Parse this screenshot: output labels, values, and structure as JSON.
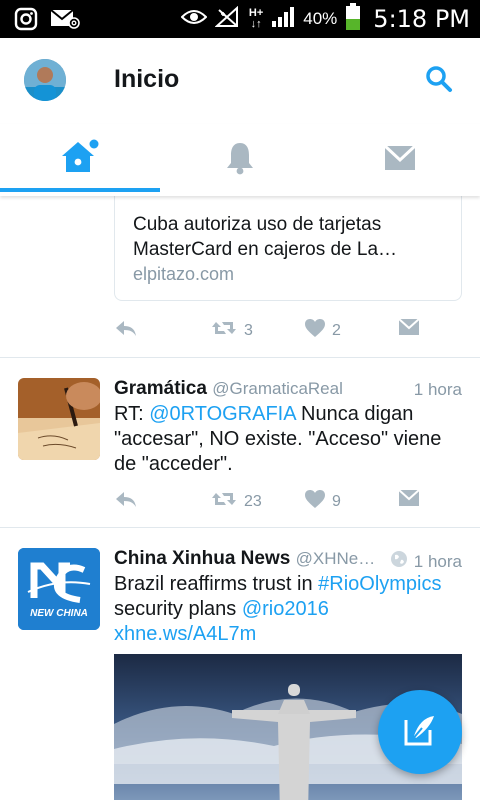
{
  "status_bar": {
    "battery_percent": "40%",
    "time": "5:18 PM",
    "network": "H+",
    "icons": [
      "instagram-icon",
      "mail-icon",
      "eye-icon",
      "no-signal-icon",
      "network-arrows-icon",
      "signal-icon",
      "battery-icon"
    ]
  },
  "header": {
    "title": "Inicio",
    "search_icon": "search-icon"
  },
  "tabs": [
    {
      "name": "home",
      "icon": "home-icon",
      "active": true
    },
    {
      "name": "notifications",
      "icon": "bell-icon",
      "active": false
    },
    {
      "name": "messages",
      "icon": "envelope-icon",
      "active": false
    }
  ],
  "colors": {
    "accent": "#1da1f2",
    "text": "#14171a",
    "secondary": "#8899a6"
  },
  "feed": {
    "card": {
      "title": "Cuba autoriza uso de tarjetas\nMasterCard en cajeros de La…",
      "domain": "elpitazo.com",
      "retweets": "3",
      "likes": "2"
    },
    "tweets": [
      {
        "name": "Gramática",
        "handle": "@GramaticaReal",
        "time": "1 hora",
        "text_prefix": "RT: ",
        "mention": "@0RTOGRAFIA",
        "text_rest": " Nunca digan \"accesar\", NO existe. \"Acceso\" viene de \"acceder\".",
        "retweets": "23",
        "likes": "9"
      },
      {
        "name": "China Xinhua News",
        "handle": "@XHNe…",
        "time": "1 hora",
        "text_prefix": "Brazil reaffirms trust in ",
        "hashtag": "#RioOlympics",
        "text_mid": " security plans ",
        "mention": "@rio2016",
        "url": "xhne.ws/A4L7m",
        "avatar_text": "NEW CHINA"
      }
    ]
  },
  "fab": {
    "icon": "compose-tweet-icon"
  }
}
